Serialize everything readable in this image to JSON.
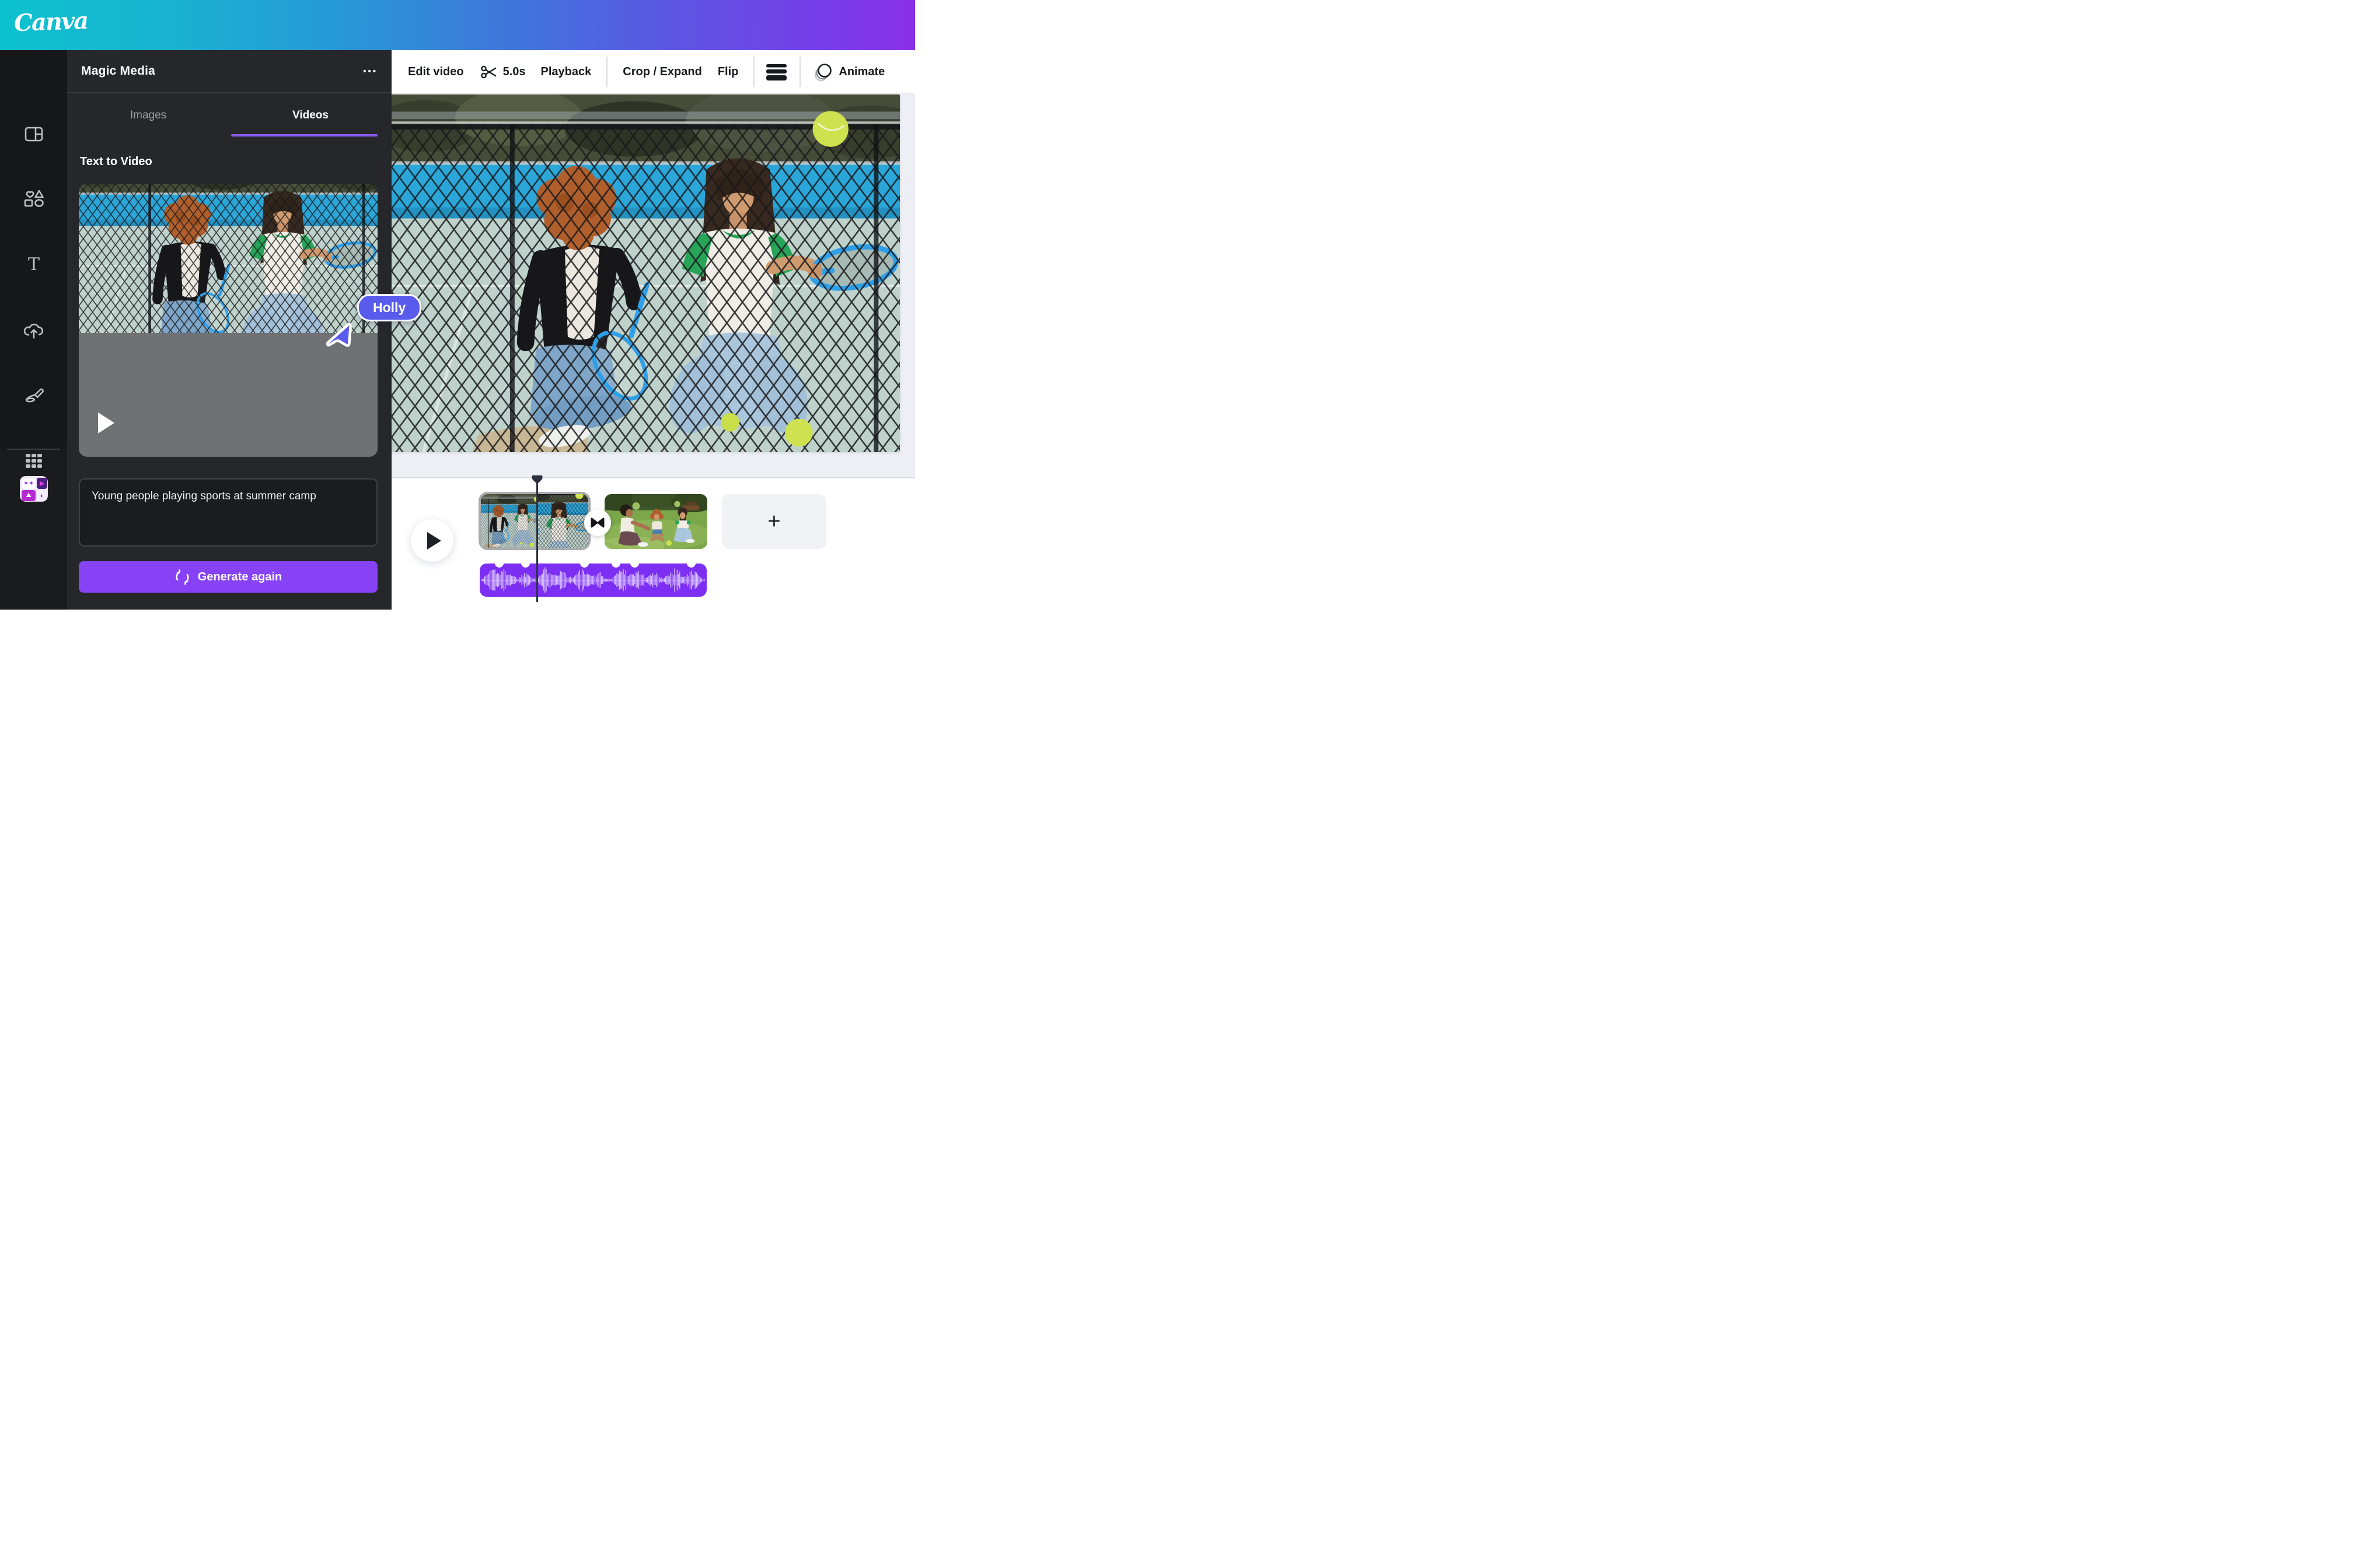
{
  "theme": {
    "accent_purple": "#8642f4",
    "tab_underline": "#8a5bf7",
    "audio_track_purple": "#7c2ff2",
    "collaborator_blue": "#585beb",
    "header_gradient": [
      "#0dc2ce",
      "#2897d6",
      "#5f53e3",
      "#8a2fe8"
    ],
    "panel_bg": "#26272b",
    "sidebar_bg": "#1a1b1d"
  },
  "header": {
    "logo": "Canva"
  },
  "sidebar": {
    "icons": [
      "design-icon",
      "elements-icon",
      "text-icon",
      "uploads-icon",
      "draw-icon",
      "apps-icon",
      "magic-media-app-icon"
    ]
  },
  "panel": {
    "title": "Magic Media",
    "menu_label": "•••",
    "tabs": [
      {
        "label": "Images",
        "active": false
      },
      {
        "label": "Videos",
        "active": true
      }
    ],
    "section_title": "Text to Video",
    "preview": {
      "play_icon": "play-icon"
    },
    "prompt": {
      "value": "Young people playing sports at summer camp"
    },
    "generate_button": {
      "label": "Generate again",
      "icon": "regenerate-icon"
    }
  },
  "toolbar": {
    "edit_video": "Edit video",
    "trim_icon": "scissors-icon",
    "duration": "5.0s",
    "playback": "Playback",
    "crop_expand": "Crop / Expand",
    "flip": "Flip",
    "levels_icon": "levels-icon",
    "animate_icon": "animate-icon",
    "animate": "Animate"
  },
  "collaborator": {
    "name": "Holly"
  },
  "timeline": {
    "play_button": "play-icon",
    "clips": [
      {
        "name": "tennis-court-clip",
        "selected": true
      },
      {
        "name": "summer-camp-grass-clip",
        "selected": false
      }
    ],
    "transition_icon": "transition-bowtie-icon",
    "add_label": "+",
    "audio_track": "voiceover-waveform"
  }
}
